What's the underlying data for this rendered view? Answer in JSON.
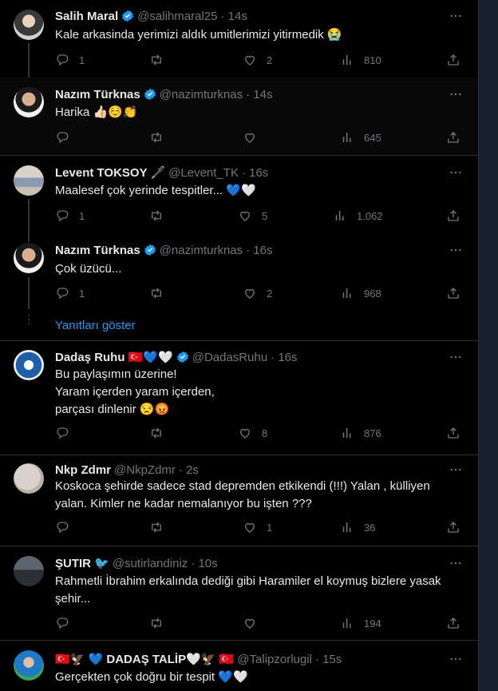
{
  "tweets": [
    {
      "name": "Salih Maral",
      "handle": "@salihmaral25",
      "time": "· 14s",
      "text": "Kale arkasinda yerimizi aldık umitlerimizi yitirmedik 😭",
      "replies": "1",
      "retweets": "",
      "likes": "2",
      "views": "810"
    },
    {
      "name": "Nazım Türknas",
      "handle": "@nazimturknas",
      "time": "· 14s",
      "text": "Harika 👍🏻☺️👏",
      "replies": "",
      "retweets": "",
      "likes": "",
      "views": "645"
    },
    {
      "name": "Levent TOKSOY 🖋️",
      "handle": "@Levent_TK",
      "time": "· 16s",
      "text": "Maalesef çok yerinde tespitler... 💙🤍",
      "replies": "1",
      "retweets": "",
      "likes": "5",
      "views": "1.062"
    },
    {
      "name": "Nazım Türknas",
      "handle": "@nazimturknas",
      "time": "· 16s",
      "text": "Çok üzücü...",
      "replies": "1",
      "retweets": "",
      "likes": "2",
      "views": "968"
    },
    {
      "name": "Dadaş Ruhu 🇹🇷💙🤍",
      "handle": "@DadasRuhu",
      "time": "· 16s",
      "text": "Bu paylaşımın üzerine!\nYaram içerden yaram içerden,\nparçası dinlenir 😒😡",
      "replies": "",
      "retweets": "",
      "likes": "8",
      "views": "876"
    },
    {
      "name": "Nkp Zdmr",
      "handle": "@NkpZdmr",
      "time": "· 2s",
      "text": "Koskoca şehirde sadece stad depremden etkikendi (!!!) Yalan , külliyen\nyalan. Kimler ne kadar nemalanıyor bu işten ???",
      "replies": "",
      "retweets": "",
      "likes": "1",
      "views": "36"
    },
    {
      "name": "ŞUTIR 🐦",
      "handle": "@sutirlandiniz",
      "time": "· 10s",
      "text": "Rahmetli İbrahim erkalında dediği gibi Haramiler el koymuş bizlere yasak\nşehir...",
      "replies": "",
      "retweets": "",
      "likes": "",
      "views": "194"
    },
    {
      "name": "🇹🇷🦅 💙 DADAŞ TALİP🤍🦅 🇹🇷",
      "handle": "@Talipzorlugil",
      "time": "· 15s",
      "text": "Gerçekten çok doğru bir tespit 💙🤍",
      "replies": "",
      "retweets": "",
      "likes": "",
      "views": ""
    }
  ],
  "show_replies_label": "Yanıtları göster",
  "colors": {
    "accent": "#1d9bf0",
    "muted": "#71767b",
    "text": "#e7e9ea",
    "border": "#2f3336"
  },
  "icons": [
    "reply-icon",
    "retweet-icon",
    "like-icon",
    "views-icon",
    "share-icon",
    "more-icon",
    "verified-icon"
  ]
}
